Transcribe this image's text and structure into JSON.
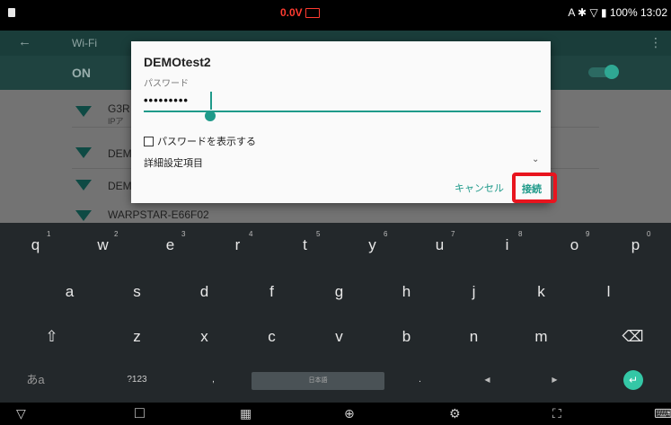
{
  "status_bar": {
    "center_text": "0.0V",
    "right_text": "A ✱ ▽ ▮ 100% 13:02"
  },
  "app_bar": {
    "back": "←",
    "title": "Wi-Fi",
    "menu": "⋮"
  },
  "wifi_switch": {
    "label": "ON"
  },
  "networks": [
    {
      "name": "G3R",
      "sub": "IPア"
    },
    {
      "name": "DEM",
      "sub": ""
    },
    {
      "name": "DEM",
      "sub": ""
    },
    {
      "name": "WARPSTAR-E66F02",
      "sub": ""
    }
  ],
  "dialog": {
    "title": "DEMOtest2",
    "password_label": "パスワード",
    "password_value": "•••••••••",
    "show_password_label": "パスワードを表示する",
    "advanced_label": "詳細設定項目",
    "advanced_chevron": "⌄",
    "cancel_label": "キャンセル",
    "connect_label": "接続"
  },
  "keyboard": {
    "row1": [
      {
        "key": "q",
        "num": "1"
      },
      {
        "key": "w",
        "num": "2"
      },
      {
        "key": "e",
        "num": "3"
      },
      {
        "key": "r",
        "num": "4"
      },
      {
        "key": "t",
        "num": "5"
      },
      {
        "key": "y",
        "num": "6"
      },
      {
        "key": "u",
        "num": "7"
      },
      {
        "key": "i",
        "num": "8"
      },
      {
        "key": "o",
        "num": "9"
      },
      {
        "key": "p",
        "num": "0"
      }
    ],
    "row2": [
      "a",
      "s",
      "d",
      "f",
      "g",
      "h",
      "j",
      "k",
      "l"
    ],
    "row3": [
      "z",
      "x",
      "c",
      "v",
      "b",
      "n",
      "m"
    ],
    "shift": "⇧",
    "backspace": "⌫",
    "mode_key": "あa",
    "symbols_key": "?123",
    "comma": ",",
    "space_label": "日本語",
    "period": ".",
    "left_arrow": "◀",
    "right_arrow": "▶",
    "enter": "↵"
  },
  "nav_bar": {
    "back": "▽",
    "home": "□",
    "recents": "▦",
    "globe": "⊕",
    "settings": "⚙",
    "screenshot": "⛶",
    "keyboard": "⌨"
  },
  "colors": {
    "accent": "#1f9a8a",
    "highlight": "#e8141e"
  }
}
